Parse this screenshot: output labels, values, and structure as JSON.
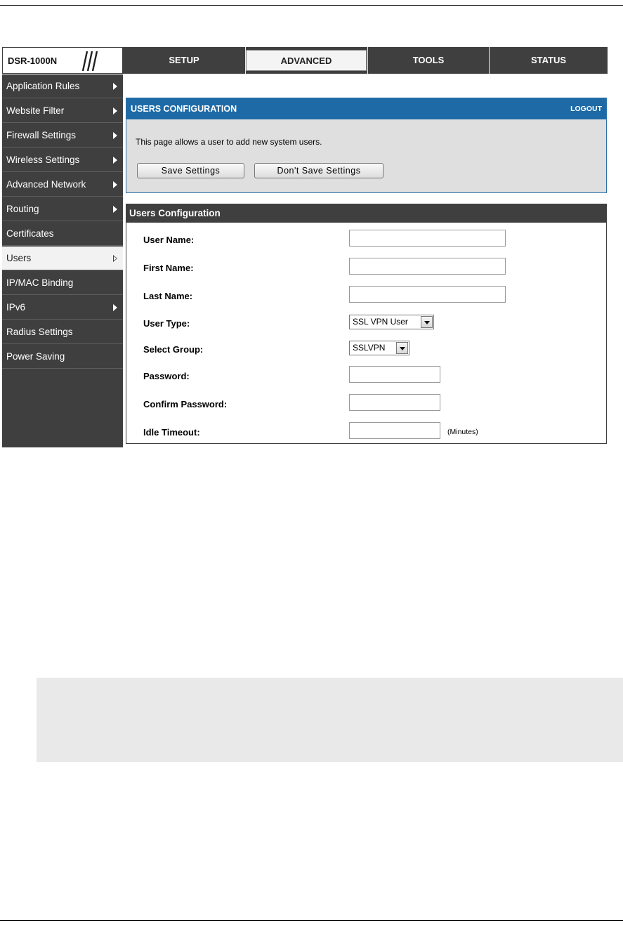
{
  "brand": {
    "model": "DSR-1000N"
  },
  "tabs": [
    {
      "label": "SETUP"
    },
    {
      "label": "ADVANCED"
    },
    {
      "label": "TOOLS"
    },
    {
      "label": "STATUS"
    }
  ],
  "active_tab": "ADVANCED",
  "sidebar": {
    "items": [
      {
        "label": "Application Rules",
        "arrow": "filled"
      },
      {
        "label": "Website Filter",
        "arrow": "filled"
      },
      {
        "label": "Firewall Settings",
        "arrow": "filled"
      },
      {
        "label": "Wireless Settings",
        "arrow": "filled"
      },
      {
        "label": "Advanced Network",
        "arrow": "filled"
      },
      {
        "label": "Routing",
        "arrow": "filled"
      },
      {
        "label": "Certificates",
        "arrow": "none"
      },
      {
        "label": "Users",
        "arrow": "outline"
      },
      {
        "label": "IP/MAC Binding",
        "arrow": "none"
      },
      {
        "label": "IPv6",
        "arrow": "filled"
      },
      {
        "label": "Radius Settings",
        "arrow": "none"
      },
      {
        "label": "Power Saving",
        "arrow": "none"
      }
    ],
    "active_item": "Users"
  },
  "intro": {
    "title": "USERS CONFIGURATION",
    "logout": "LOGOUT",
    "description": "This page allows a user to add new system users.",
    "save_label": "Save Settings",
    "dont_save_label": "Don't Save Settings"
  },
  "form": {
    "title": "Users Configuration",
    "user_name_label": "User Name:",
    "user_name_value": "",
    "first_name_label": "First Name:",
    "first_name_value": "",
    "last_name_label": "Last Name:",
    "last_name_value": "",
    "user_type_label": "User Type:",
    "user_type_value": "SSL VPN User",
    "select_group_label": "Select Group:",
    "select_group_value": "SSLVPN",
    "password_label": "Password:",
    "password_value": "",
    "confirm_password_label": "Confirm Password:",
    "confirm_password_value": "",
    "idle_timeout_label": "Idle Timeout:",
    "idle_timeout_value": "",
    "idle_timeout_units": "(Minutes)"
  },
  "colors": {
    "nav_background": "#3f3f3f",
    "header_blue": "#1d6aa6",
    "panel_grey": "#dfdfdf",
    "note_grey": "#e9e9e9"
  }
}
